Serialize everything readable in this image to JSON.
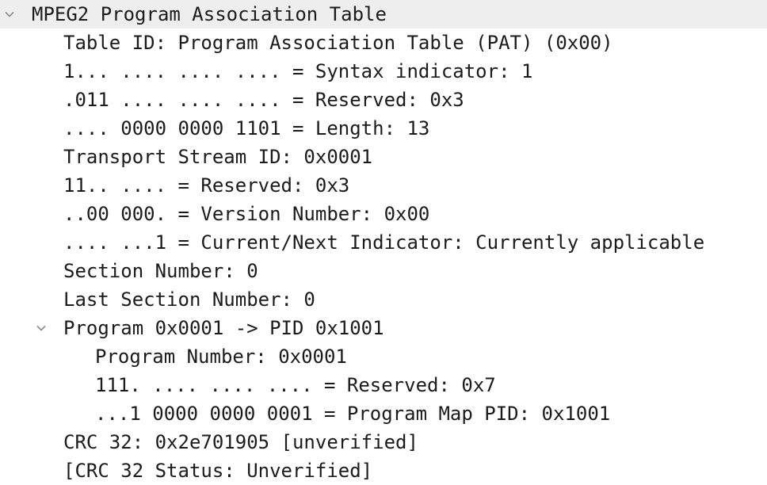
{
  "tree": {
    "root": {
      "label": "MPEG2 Program Association Table",
      "expanded": true,
      "icon": "chevron-down-icon"
    },
    "fields": [
      "Table ID: Program Association Table (PAT) (0x00)",
      "1... .... .... .... = Syntax indicator: 1",
      ".011 .... .... .... = Reserved: 0x3",
      ".... 0000 0000 1101 = Length: 13",
      "Transport Stream ID: 0x0001",
      "11.. .... = Reserved: 0x3",
      "..00 000. = Version Number: 0x00",
      ".... ...1 = Current/Next Indicator: Currently applicable",
      "Section Number: 0",
      "Last Section Number: 0"
    ],
    "program": {
      "label": "Program 0x0001 -> PID 0x1001",
      "expanded": true,
      "icon": "chevron-down-icon",
      "fields": [
        "Program Number: 0x0001",
        "111. .... .... .... = Reserved: 0x7",
        "...1 0000 0000 0001 = Program Map PID: 0x1001"
      ]
    },
    "trailer": [
      "CRC 32: 0x2e701905 [unverified]",
      "[CRC 32 Status: Unverified]"
    ]
  },
  "colors": {
    "text": "#1b1b1b",
    "header_background": "#eeeeee",
    "chevron": "#8a8a8a"
  }
}
